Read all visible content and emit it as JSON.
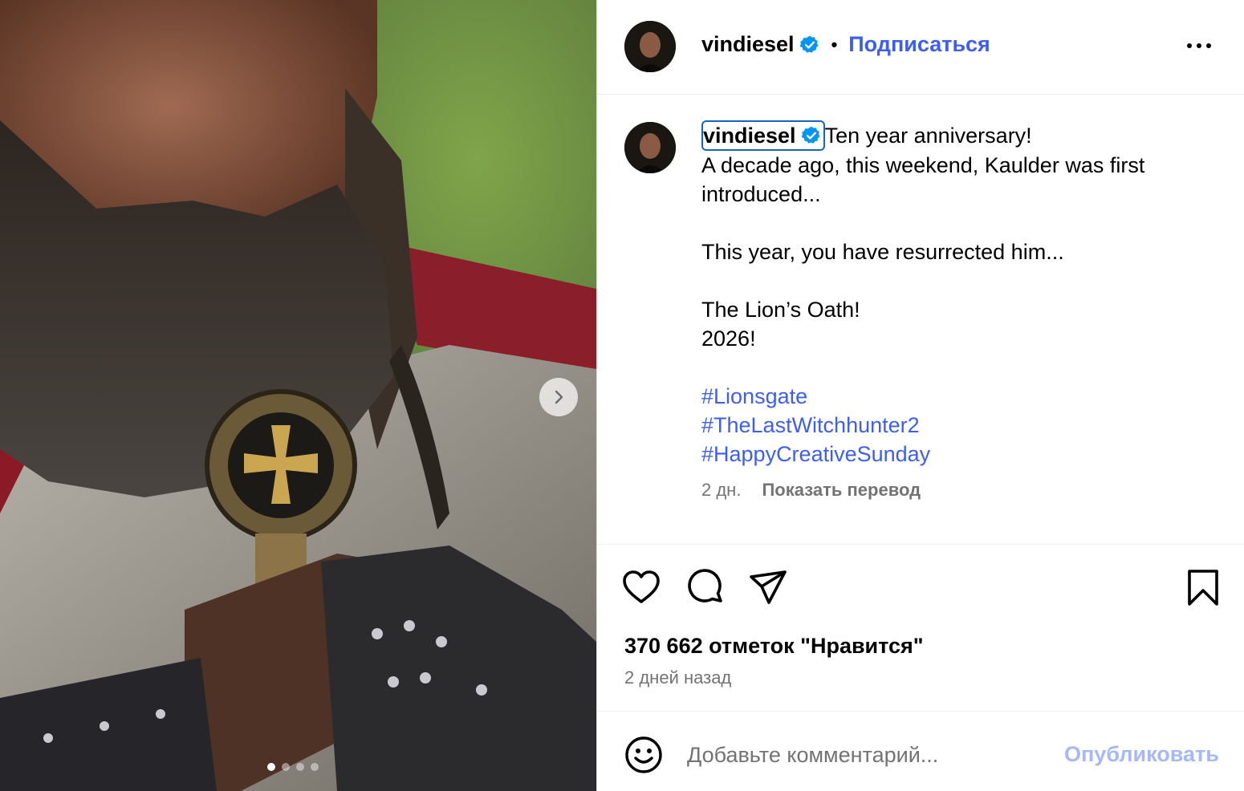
{
  "post": {
    "username": "vindiesel",
    "follow_label": "Подписаться",
    "separator": "•"
  },
  "caption": {
    "username": "vindiesel",
    "lines": [
      "Ten year anniversary!",
      "A decade ago, this weekend, Kaulder was first",
      "introduced...",
      "",
      "This year, you have resurrected him...",
      "",
      "The Lion’s Oath!",
      "2026!",
      ""
    ],
    "hashtags": [
      "#Lionsgate",
      "#TheLastWitchhunter2",
      "#HappyCreativeSunday"
    ],
    "time": "2 дн.",
    "translate_label": "Показать перевод"
  },
  "engagement": {
    "likes": "370 662 отметок \"Нравится\"",
    "posted_ago": "2 дней назад"
  },
  "comment": {
    "placeholder": "Добавьте комментарий...",
    "publish_label": "Опубликовать"
  },
  "carousel": {
    "slide_count": 4,
    "active_index": 0
  },
  "colors": {
    "link_blue": "#3d5ef0",
    "verified_blue": "#0095f6",
    "muted_gray": "#737373",
    "publish_disabled": "#a7b8f7"
  },
  "icons": [
    "chevron-right-icon",
    "verified-badge-icon",
    "more-options-icon",
    "heart-icon",
    "comment-icon",
    "share-icon",
    "bookmark-icon",
    "emoji-icon"
  ]
}
